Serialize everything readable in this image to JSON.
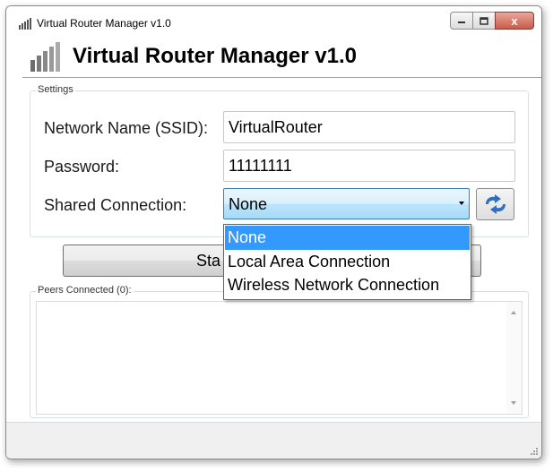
{
  "window": {
    "title": "Virtual Router Manager v1.0",
    "close_glyph": "x"
  },
  "header": {
    "title": "Virtual Router Manager v1.0",
    "icon": "signal-bars-icon"
  },
  "settings": {
    "legend": "Settings",
    "ssid_label": "Network Name (SSID):",
    "ssid_value": "VirtualRouter",
    "password_label": "Password:",
    "password_value": "11111111",
    "shared_label": "Shared Connection:",
    "shared_value": "None",
    "refresh_icon": "refresh-arrows-icon"
  },
  "start_button": {
    "label": "Sta"
  },
  "peers": {
    "legend": "Peers Connected (0):"
  },
  "dropdown": {
    "options": [
      "None",
      "Local Area Connection",
      "Wireless Network Connection"
    ],
    "selected_index": 0
  },
  "colors": {
    "selection": "#3399ff",
    "combo_border": "#3c7fb1",
    "close_button": "#c95b4a"
  }
}
